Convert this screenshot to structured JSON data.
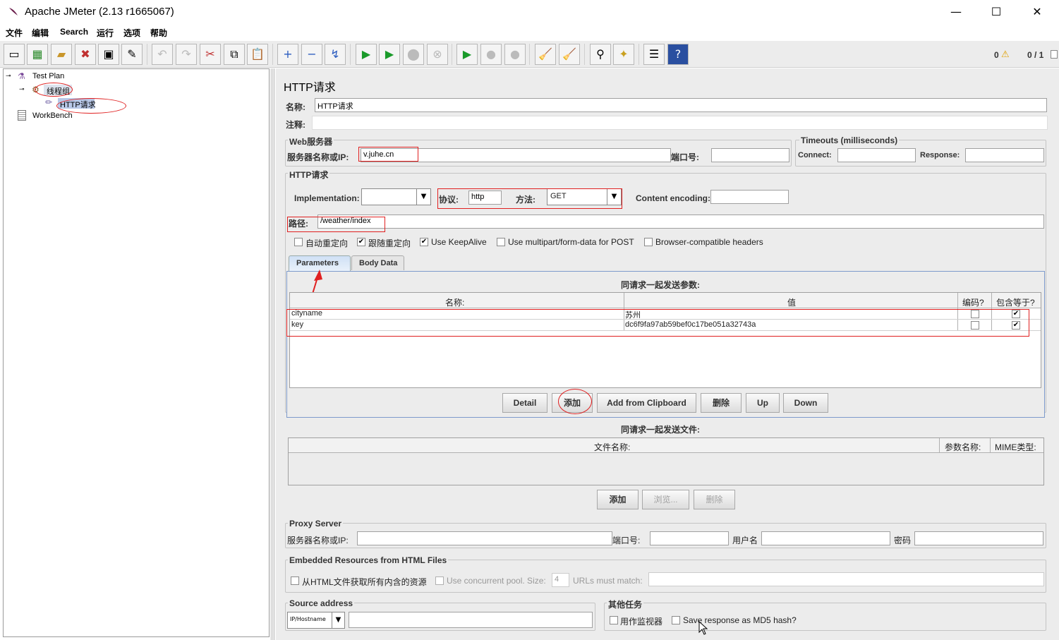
{
  "window": {
    "title": "Apache JMeter (2.13 r1665067)",
    "minimize": "—",
    "maximize": "☐",
    "close": "✕"
  },
  "menu": [
    "文件",
    "编辑",
    "Search",
    "运行",
    "选项",
    "帮助"
  ],
  "toolbar": {
    "warnings": "0",
    "threads": "0 / 1"
  },
  "tree": {
    "test_plan": "Test Plan",
    "thread_group": "线程组",
    "http_request": "HTTP请求",
    "workbench": "WorkBench"
  },
  "panel": {
    "title": "HTTP请求",
    "name_label": "名称:",
    "name_value": "HTTP请求",
    "comment_label": "注释:",
    "comment_value": "",
    "web_server": {
      "title": "Web服务器",
      "server_label": "服务器名称或IP:",
      "server_value": "v.juhe.cn",
      "port_label": "端口号:",
      "port_value": ""
    },
    "timeouts": {
      "title": "Timeouts (milliseconds)",
      "connect_label": "Connect:",
      "connect_value": "",
      "response_label": "Response:",
      "response_value": ""
    },
    "http": {
      "title": "HTTP请求",
      "impl_label": "Implementation:",
      "impl_value": "",
      "protocol_label": "协议:",
      "protocol_value": "http",
      "method_label": "方法:",
      "method_value": "GET",
      "encoding_label": "Content encoding:",
      "encoding_value": "",
      "path_label": "路径:",
      "path_value": "/weather/index"
    },
    "options": [
      {
        "label": "自动重定向",
        "checked": false
      },
      {
        "label": "跟随重定向",
        "checked": true
      },
      {
        "label": "Use KeepAlive",
        "checked": true
      },
      {
        "label": "Use multipart/form-data for POST",
        "checked": false
      },
      {
        "label": "Browser-compatible headers",
        "checked": false
      }
    ],
    "tabs": [
      "Parameters",
      "Body Data"
    ],
    "params_title": "同请求一起发送参数:",
    "params_headers": [
      "名称:",
      "值",
      "编码?",
      "包含等于?"
    ],
    "params_rows": [
      {
        "name": "cityname",
        "value": "苏州",
        "encode": false,
        "include_equals": true
      },
      {
        "name": "key",
        "value": "dc6f9fa97ab59bef0c17be051a32743a",
        "encode": false,
        "include_equals": true
      }
    ],
    "param_buttons": [
      "Detail",
      "添加",
      "Add from Clipboard",
      "删除",
      "Up",
      "Down"
    ],
    "files_title": "同请求一起发送文件:",
    "files_headers": [
      "文件名称:",
      "参数名称:",
      "MIME类型:"
    ],
    "file_buttons": [
      "添加",
      "浏览...",
      "删除"
    ],
    "proxy": {
      "title": "Proxy Server",
      "server_label": "服务器名称或IP:",
      "port_label": "端口号:",
      "user_label": "用户名",
      "password_label": "密码"
    },
    "embedded": {
      "title": "Embedded Resources from HTML Files",
      "fetch_label": "从HTML文件获取所有内含的资源",
      "pool_label": "Use concurrent pool. Size:",
      "pool_size": "4",
      "urls_label": "URLs must match:"
    },
    "source": {
      "title": "Source address",
      "type_value": "IP/Hostname"
    },
    "other": {
      "title": "其他任务",
      "monitor_label": "用作监视器",
      "md5_label": "Save response as MD5 hash?"
    }
  }
}
